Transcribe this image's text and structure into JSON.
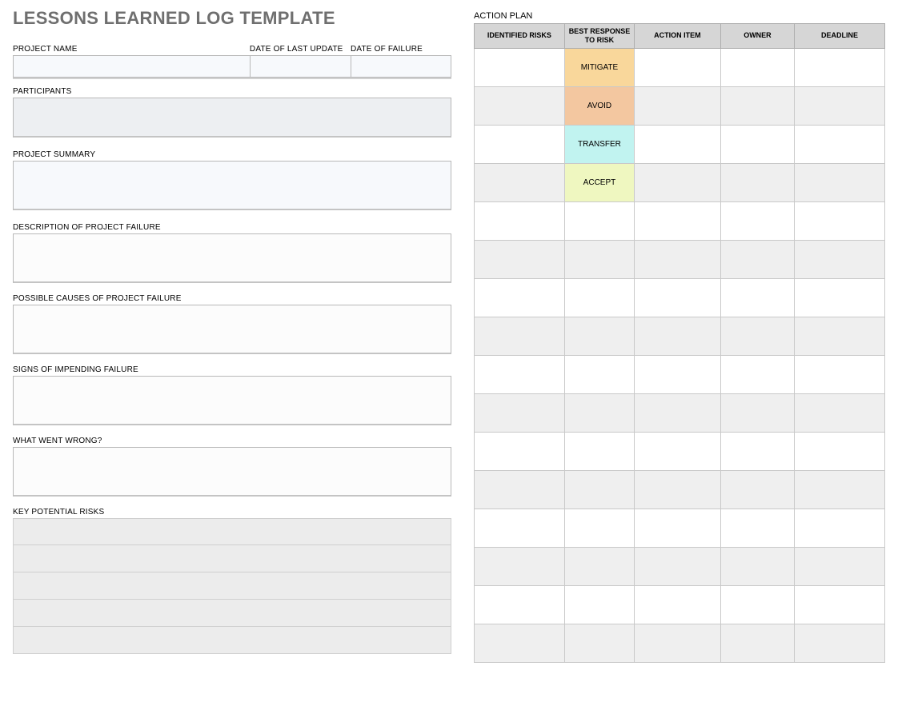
{
  "title": "LESSONS LEARNED LOG TEMPLATE",
  "left": {
    "project_name_label": "PROJECT NAME",
    "date_last_update_label": "DATE OF LAST UPDATE",
    "date_failure_label": "DATE OF FAILURE",
    "participants_label": "PARTICIPANTS",
    "summary_label": "PROJECT SUMMARY",
    "desc_failure_label": "DESCRIPTION OF PROJECT FAILURE",
    "causes_label": "POSSIBLE CAUSES OF PROJECT FAILURE",
    "signs_label": "SIGNS OF IMPENDING FAILURE",
    "wrong_label": "WHAT WENT WRONG?",
    "risks_label": "KEY POTENTIAL RISKS",
    "project_name": "",
    "date_last_update": "",
    "date_failure": "",
    "participants": "",
    "summary": "",
    "desc_failure": "",
    "causes": "",
    "signs": "",
    "wrong": "",
    "risk_rows": [
      "",
      "",
      "",
      "",
      ""
    ]
  },
  "right": {
    "action_plan_label": "ACTION PLAN",
    "headers": {
      "risks": "IDENTIFIED RISKS",
      "response": "BEST RESPONSE TO RISK",
      "action": "ACTION ITEM",
      "owner": "OWNER",
      "deadline": "DEADLINE"
    },
    "responses": {
      "mitigate": "MITIGATE",
      "avoid": "AVOID",
      "transfer": "TRANSFER",
      "accept": "ACCEPT"
    },
    "rows": [
      {
        "shaded": false,
        "response_key": "mitigate",
        "risk": "",
        "action": "",
        "owner": "",
        "deadline": ""
      },
      {
        "shaded": true,
        "response_key": "avoid",
        "risk": "",
        "action": "",
        "owner": "",
        "deadline": ""
      },
      {
        "shaded": false,
        "response_key": "transfer",
        "risk": "",
        "action": "",
        "owner": "",
        "deadline": ""
      },
      {
        "shaded": true,
        "response_key": "accept",
        "risk": "",
        "action": "",
        "owner": "",
        "deadline": ""
      },
      {
        "shaded": false,
        "response_key": "",
        "risk": "",
        "action": "",
        "owner": "",
        "deadline": ""
      },
      {
        "shaded": true,
        "response_key": "",
        "risk": "",
        "action": "",
        "owner": "",
        "deadline": ""
      },
      {
        "shaded": false,
        "response_key": "",
        "risk": "",
        "action": "",
        "owner": "",
        "deadline": ""
      },
      {
        "shaded": true,
        "response_key": "",
        "risk": "",
        "action": "",
        "owner": "",
        "deadline": ""
      },
      {
        "shaded": false,
        "response_key": "",
        "risk": "",
        "action": "",
        "owner": "",
        "deadline": ""
      },
      {
        "shaded": true,
        "response_key": "",
        "risk": "",
        "action": "",
        "owner": "",
        "deadline": ""
      },
      {
        "shaded": false,
        "response_key": "",
        "risk": "",
        "action": "",
        "owner": "",
        "deadline": ""
      },
      {
        "shaded": true,
        "response_key": "",
        "risk": "",
        "action": "",
        "owner": "",
        "deadline": ""
      },
      {
        "shaded": false,
        "response_key": "",
        "risk": "",
        "action": "",
        "owner": "",
        "deadline": ""
      },
      {
        "shaded": true,
        "response_key": "",
        "risk": "",
        "action": "",
        "owner": "",
        "deadline": ""
      },
      {
        "shaded": false,
        "response_key": "",
        "risk": "",
        "action": "",
        "owner": "",
        "deadline": ""
      },
      {
        "shaded": true,
        "response_key": "",
        "risk": "",
        "action": "",
        "owner": "",
        "deadline": ""
      }
    ]
  }
}
